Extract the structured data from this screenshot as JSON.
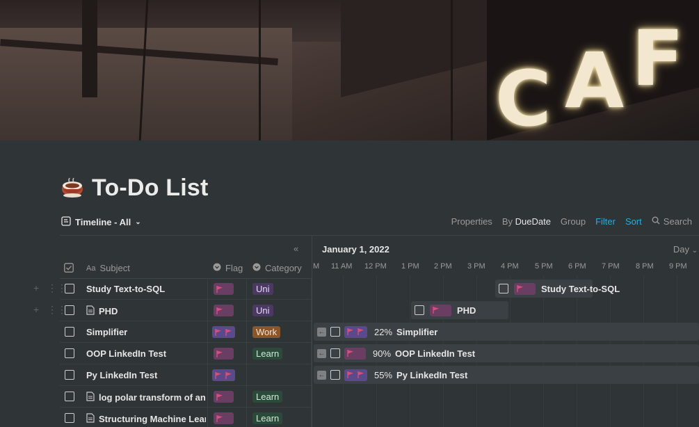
{
  "page": {
    "title": "To-Do List"
  },
  "view": {
    "name": "Timeline - All"
  },
  "toolbar": {
    "properties": "Properties",
    "by_prefix": "By",
    "by_field": "DueDate",
    "group": "Group",
    "filter": "Filter",
    "sort": "Sort",
    "search": "Search"
  },
  "columns": {
    "subject": "Subject",
    "flag": "Flag",
    "category": "Category"
  },
  "timeline": {
    "date": "January 1, 2022",
    "scale": "Day",
    "hours": [
      "M",
      "11 AM",
      "12 PM",
      "1 PM",
      "2 PM",
      "3 PM",
      "4 PM",
      "5 PM",
      "6 PM",
      "7 PM",
      "8 PM",
      "9 PM"
    ]
  },
  "rows": [
    {
      "subject": "Study Text-to-SQL",
      "flags": 1,
      "category": "Uni",
      "doc": false
    },
    {
      "subject": "PHD",
      "flags": 1,
      "category": "Uni",
      "doc": true
    },
    {
      "subject": "Simplifier",
      "flags": 2,
      "category": "Work",
      "doc": false
    },
    {
      "subject": "OOP LinkedIn Test",
      "flags": 1,
      "category": "Learn",
      "doc": false
    },
    {
      "subject": "Py LinkedIn Test",
      "flags": 2,
      "category": "",
      "doc": false
    },
    {
      "subject": "log polar transform of an",
      "flags": 1,
      "category": "Learn",
      "doc": true
    },
    {
      "subject": "Structuring Machine Lear",
      "flags": 1,
      "category": "Learn",
      "doc": true
    }
  ],
  "bars": [
    {
      "label": "Study Text-to-SQL",
      "percent": ""
    },
    {
      "label": "PHD",
      "percent": ""
    },
    {
      "label": "Simplifier",
      "percent": "22%"
    },
    {
      "label": "OOP LinkedIn Test",
      "percent": "90%"
    },
    {
      "label": "Py LinkedIn Test",
      "percent": "55%"
    }
  ],
  "colors": {
    "flag_pink": "#d64f7a",
    "tag_uni": "#4b3863",
    "tag_work": "#89552a",
    "tag_learn": "#2c4a3a",
    "accent": "#2eaadc"
  }
}
